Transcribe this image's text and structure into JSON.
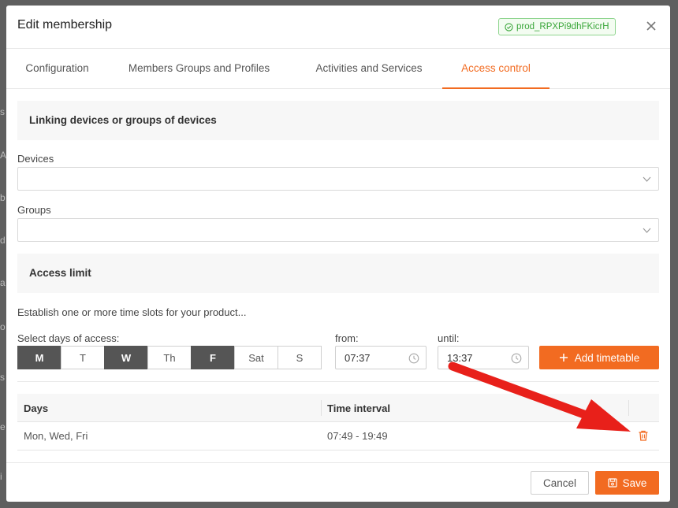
{
  "backdrop": {
    "fragments": [
      "s",
      "A",
      "b",
      "d",
      "a",
      "o",
      "s",
      "e",
      "i"
    ]
  },
  "modal": {
    "title": "Edit membership",
    "product_id": "prod_RPXPi9dhFKicrH",
    "close_icon": "close-icon"
  },
  "tabs": [
    {
      "label": "Configuration",
      "active": false
    },
    {
      "label": "Members Groups and Profiles",
      "active": false
    },
    {
      "label": "Activities and Services",
      "active": false
    },
    {
      "label": "Access control",
      "active": true
    }
  ],
  "linking": {
    "title": "Linking devices or groups of devices",
    "devices_label": "Devices",
    "devices_value": "",
    "groups_label": "Groups",
    "groups_value": ""
  },
  "access_limit": {
    "title": "Access limit",
    "help_text": "Establish one or more time slots for your product...",
    "days_label": "Select days of access:",
    "days": [
      {
        "label": "M",
        "selected": true
      },
      {
        "label": "T",
        "selected": false
      },
      {
        "label": "W",
        "selected": true
      },
      {
        "label": "Th",
        "selected": false
      },
      {
        "label": "F",
        "selected": true
      },
      {
        "label": "Sat",
        "selected": false
      },
      {
        "label": "S",
        "selected": false
      }
    ],
    "from_label": "from:",
    "from_value": "07:37",
    "until_label": "until:",
    "until_value": "13:37",
    "add_button": "Add timetable"
  },
  "table": {
    "headers": [
      "Days",
      "Time interval"
    ],
    "rows": [
      {
        "days": "Mon, Wed, Fri",
        "interval": "07:49 - 19:49"
      }
    ]
  },
  "footer": {
    "cancel": "Cancel",
    "save": "Save"
  },
  "colors": {
    "accent": "#f26b21",
    "badge_green": "#3aa63a",
    "annotation_arrow": "#e8201a"
  }
}
